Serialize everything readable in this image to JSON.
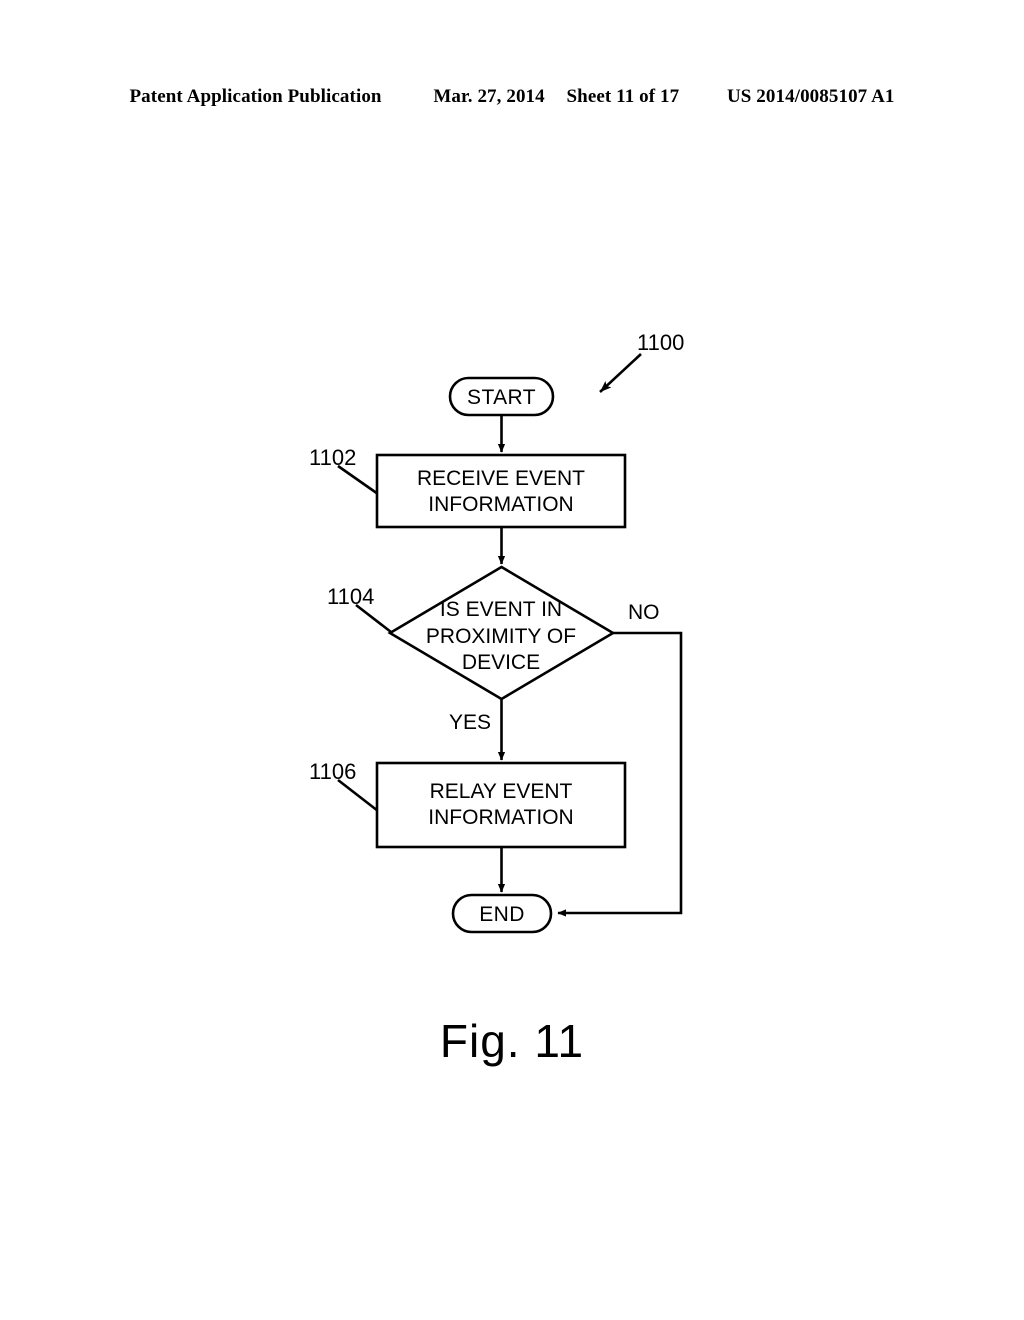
{
  "header": {
    "publication": "Patent Application Publication",
    "date": "Mar. 27, 2014",
    "sheet": "Sheet 11 of 17",
    "patent_number": "US 2014/0085107 A1"
  },
  "figure": {
    "caption": "Fig. 11",
    "diagram_reference": "1100"
  },
  "flowchart": {
    "type": "flowchart",
    "nodes": [
      {
        "id": "start",
        "shape": "terminator",
        "label": "START",
        "ref": null
      },
      {
        "id": "receive",
        "shape": "process",
        "label_line1": "RECEIVE EVENT",
        "label_line2": "INFORMATION",
        "ref": "1102"
      },
      {
        "id": "decision",
        "shape": "decision",
        "label_line1": "IS EVENT IN",
        "label_line2": "PROXIMITY OF",
        "label_line3": "DEVICE",
        "ref": "1104"
      },
      {
        "id": "relay",
        "shape": "process",
        "label_line1": "RELAY EVENT",
        "label_line2": "INFORMATION",
        "ref": "1106"
      },
      {
        "id": "end",
        "shape": "terminator",
        "label": "END",
        "ref": null
      }
    ],
    "edges": [
      {
        "from": "start",
        "to": "receive",
        "label": ""
      },
      {
        "from": "receive",
        "to": "decision",
        "label": ""
      },
      {
        "from": "decision",
        "to": "relay",
        "label": "YES"
      },
      {
        "from": "decision",
        "to": "end",
        "label": "NO"
      },
      {
        "from": "relay",
        "to": "end",
        "label": ""
      }
    ]
  },
  "colors": {
    "ink": "#000000",
    "paper": "#ffffff"
  }
}
